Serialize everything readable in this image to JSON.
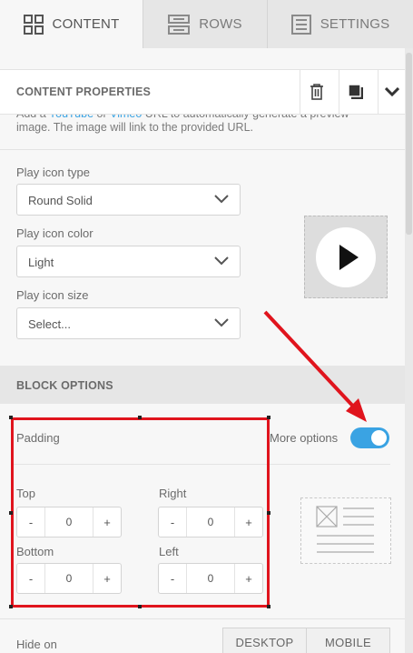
{
  "tabs": [
    {
      "label": "CONTENT",
      "icon": "grid-icon",
      "active": true
    },
    {
      "label": "ROWS",
      "icon": "rows-icon",
      "active": false
    },
    {
      "label": "SETTINGS",
      "icon": "settings-doc-icon",
      "active": false
    }
  ],
  "content_properties": {
    "title": "CONTENT PROPERTIES",
    "actions": [
      "trash-icon",
      "duplicate-icon",
      "chevron-down-icon"
    ]
  },
  "helper": {
    "text_a": "Add a ",
    "link_youtube": "YouTube",
    "text_or": " or ",
    "link_vimeo": "Vimeo",
    "text_b": " URL to automatically generate a preview image. The image will link to the provided URL."
  },
  "play_icon_type": {
    "label": "Play icon type",
    "value": "Round Solid"
  },
  "play_icon_color": {
    "label": "Play icon color",
    "value": "Light"
  },
  "play_icon_size": {
    "label": "Play icon size",
    "value": "Select..."
  },
  "block_options": {
    "title": "BLOCK OPTIONS",
    "padding_label": "Padding",
    "more_options_label": "More options",
    "more_options_on": true,
    "top": {
      "label": "Top",
      "value": "0"
    },
    "right": {
      "label": "Right",
      "value": "0"
    },
    "bottom": {
      "label": "Bottom",
      "value": "0"
    },
    "left": {
      "label": "Left",
      "value": "0"
    },
    "minus": "-",
    "plus": "+"
  },
  "hide_on": {
    "label": "Hide on",
    "options": [
      "DESKTOP",
      "MOBILE"
    ]
  },
  "colors": {
    "accent": "#3aa3e3",
    "annotation": "#e0141d"
  }
}
